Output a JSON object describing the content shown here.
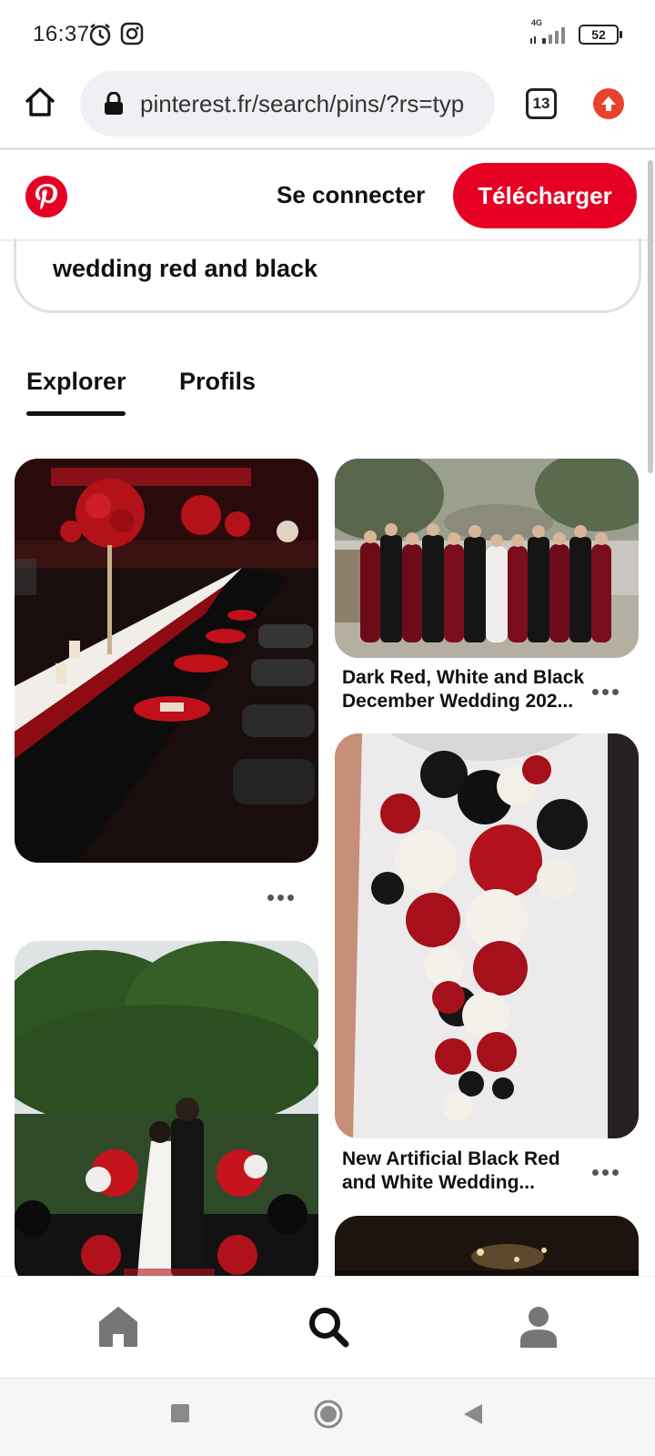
{
  "status_bar": {
    "time": "16:37",
    "network": "4G",
    "battery": "52"
  },
  "browser": {
    "url": "pinterest.fr/search/pins/?rs=typ",
    "tab_count": "13"
  },
  "header": {
    "login_label": "Se connecter",
    "download_label": "Télécharger",
    "brand_color": "#e60023"
  },
  "search": {
    "query": "wedding red and black"
  },
  "tabs": [
    {
      "label": "Explorer",
      "active": true
    },
    {
      "label": "Profils",
      "active": false
    }
  ],
  "pins": [
    {
      "title": ""
    },
    {
      "title": "Dark Red, White and Black December Wedding 202..."
    },
    {
      "title": ""
    },
    {
      "title": "New Artificial Black Red and White Wedding..."
    },
    {
      "title": ""
    }
  ],
  "bottom_nav": [
    {
      "icon": "home-icon",
      "active": false
    },
    {
      "icon": "search-icon",
      "active": true
    },
    {
      "icon": "profile-icon",
      "active": false
    }
  ]
}
